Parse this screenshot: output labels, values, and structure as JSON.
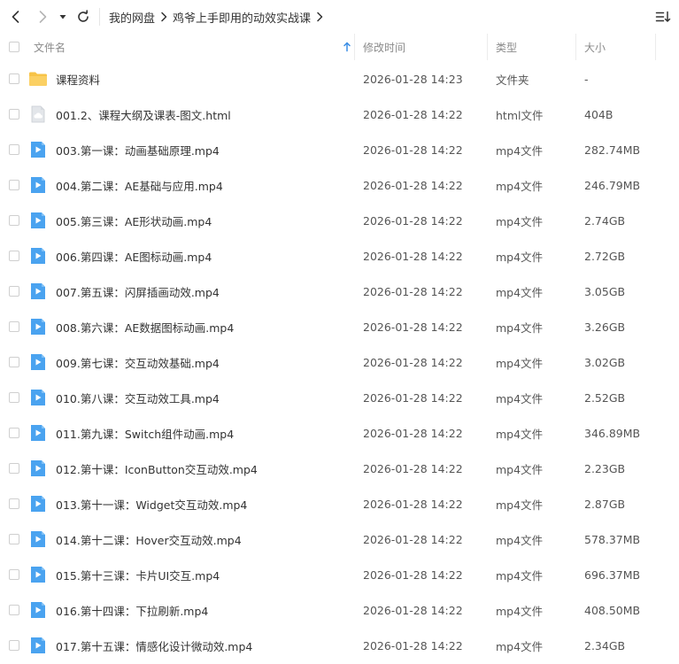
{
  "breadcrumb": {
    "root": "我的网盘",
    "current": "鸡爷上手即用的动效实战课"
  },
  "columns": {
    "name": "文件名",
    "modified": "修改时间",
    "type": "类型",
    "size": "大小"
  },
  "colors": {
    "folder": "#f7c347",
    "video": "#4aa3f0",
    "doc": "#c9cdd3",
    "sort_arrow": "#3a8ee6"
  },
  "files": [
    {
      "icon": "folder-icon",
      "name": "课程资料",
      "modified": "2026-01-28 14:23",
      "type": "文件夹",
      "size": "-"
    },
    {
      "icon": "cloud-doc-icon",
      "name": "001.2、课程大纲及课表-图文.html",
      "modified": "2026-01-28 14:22",
      "type": "html文件",
      "size": "404B"
    },
    {
      "icon": "video-file-icon",
      "name": "003.第一课：动画基础原理.mp4",
      "modified": "2026-01-28 14:22",
      "type": "mp4文件",
      "size": "282.74MB"
    },
    {
      "icon": "video-file-icon",
      "name": "004.第二课：AE基础与应用.mp4",
      "modified": "2026-01-28 14:22",
      "type": "mp4文件",
      "size": "246.79MB"
    },
    {
      "icon": "video-file-icon",
      "name": "005.第三课：AE形状动画.mp4",
      "modified": "2026-01-28 14:22",
      "type": "mp4文件",
      "size": "2.74GB"
    },
    {
      "icon": "video-file-icon",
      "name": "006.第四课：AE图标动画.mp4",
      "modified": "2026-01-28 14:22",
      "type": "mp4文件",
      "size": "2.72GB"
    },
    {
      "icon": "video-file-icon",
      "name": "007.第五课：闪屏插画动效.mp4",
      "modified": "2026-01-28 14:22",
      "type": "mp4文件",
      "size": "3.05GB"
    },
    {
      "icon": "video-file-icon",
      "name": "008.第六课：AE数据图标动画.mp4",
      "modified": "2026-01-28 14:22",
      "type": "mp4文件",
      "size": "3.26GB"
    },
    {
      "icon": "video-file-icon",
      "name": "009.第七课：交互动效基础.mp4",
      "modified": "2026-01-28 14:22",
      "type": "mp4文件",
      "size": "3.02GB"
    },
    {
      "icon": "video-file-icon",
      "name": "010.第八课：交互动效工具.mp4",
      "modified": "2026-01-28 14:22",
      "type": "mp4文件",
      "size": "2.52GB"
    },
    {
      "icon": "video-file-icon",
      "name": "011.第九课：Switch组件动画.mp4",
      "modified": "2026-01-28 14:22",
      "type": "mp4文件",
      "size": "346.89MB"
    },
    {
      "icon": "video-file-icon",
      "name": "012.第十课：IconButton交互动效.mp4",
      "modified": "2026-01-28 14:22",
      "type": "mp4文件",
      "size": "2.23GB"
    },
    {
      "icon": "video-file-icon",
      "name": "013.第十一课：Widget交互动效.mp4",
      "modified": "2026-01-28 14:22",
      "type": "mp4文件",
      "size": "2.87GB"
    },
    {
      "icon": "video-file-icon",
      "name": "014.第十二课：Hover交互动效.mp4",
      "modified": "2026-01-28 14:22",
      "type": "mp4文件",
      "size": "578.37MB"
    },
    {
      "icon": "video-file-icon",
      "name": "015.第十三课：卡片UI交互.mp4",
      "modified": "2026-01-28 14:22",
      "type": "mp4文件",
      "size": "696.37MB"
    },
    {
      "icon": "video-file-icon",
      "name": "016.第十四课：下拉刷新.mp4",
      "modified": "2026-01-28 14:22",
      "type": "mp4文件",
      "size": "408.50MB"
    },
    {
      "icon": "video-file-icon",
      "name": "017.第十五课：情感化设计微动效.mp4",
      "modified": "2026-01-28 14:22",
      "type": "mp4文件",
      "size": "2.34GB"
    }
  ]
}
